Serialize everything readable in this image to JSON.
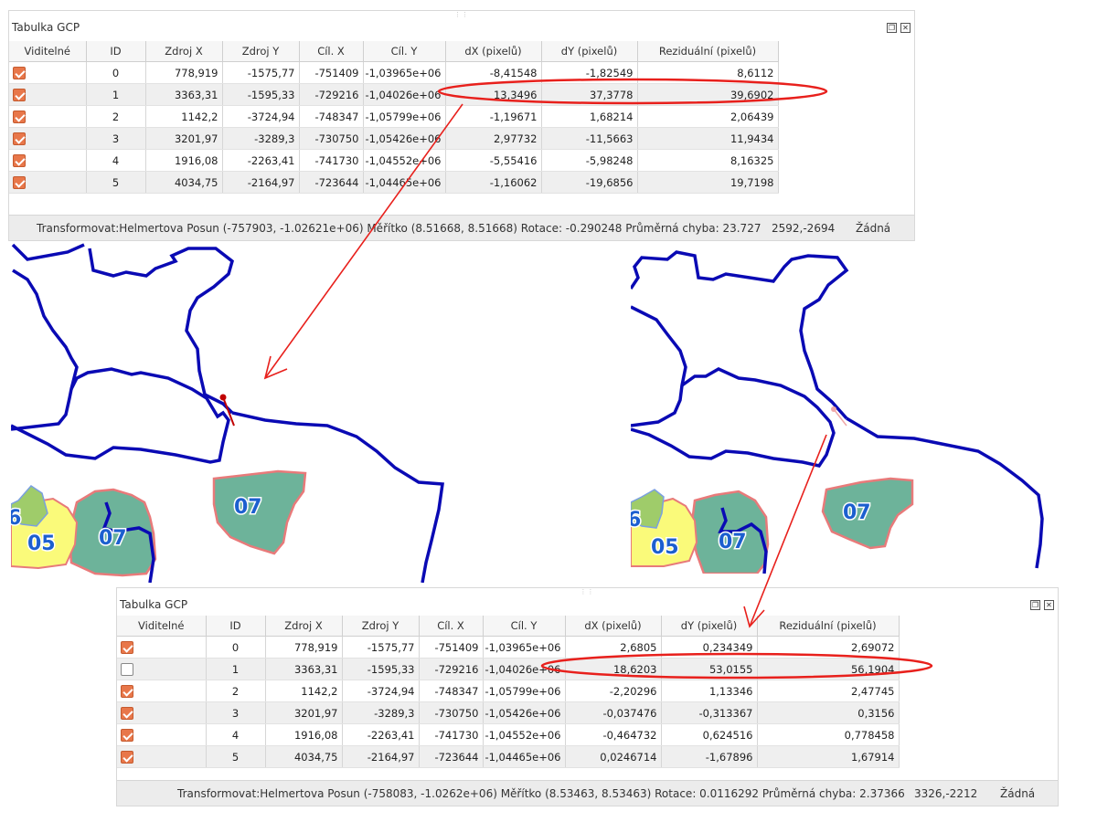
{
  "top_panel": {
    "title": "Tabulka GCP",
    "columns": [
      "Viditelné",
      "ID",
      "Zdroj X",
      "Zdroj Y",
      "Cíl. X",
      "Cíl. Y",
      "dX (pixelů)",
      "dY (pixelů)",
      "Reziduální (pixelů)"
    ],
    "rows": [
      {
        "visible": true,
        "id": "0",
        "src_x": "778,919",
        "src_y": "-1575,77",
        "dst_x": "-751409",
        "dst_y": "-1,03965e+06",
        "dx": "-8,41548",
        "dy": "-1,82549",
        "res": "8,6112"
      },
      {
        "visible": true,
        "id": "1",
        "src_x": "3363,31",
        "src_y": "-1595,33",
        "dst_x": "-729216",
        "dst_y": "-1,04026e+06",
        "dx": "13,3496",
        "dy": "37,3778",
        "res": "39,6902"
      },
      {
        "visible": true,
        "id": "2",
        "src_x": "1142,2",
        "src_y": "-3724,94",
        "dst_x": "-748347",
        "dst_y": "-1,05799e+06",
        "dx": "-1,19671",
        "dy": "1,68214",
        "res": "2,06439"
      },
      {
        "visible": true,
        "id": "3",
        "src_x": "3201,97",
        "src_y": "-3289,3",
        "dst_x": "-730750",
        "dst_y": "-1,05426e+06",
        "dx": "2,97732",
        "dy": "-11,5663",
        "res": "11,9434"
      },
      {
        "visible": true,
        "id": "4",
        "src_x": "1916,08",
        "src_y": "-2263,41",
        "dst_x": "-741730",
        "dst_y": "-1,04552e+06",
        "dx": "-5,55416",
        "dy": "-5,98248",
        "res": "8,16325"
      },
      {
        "visible": true,
        "id": "5",
        "src_x": "4034,75",
        "src_y": "-2164,97",
        "dst_x": "-723644",
        "dst_y": "-1,04465e+06",
        "dx": "-1,16062",
        "dy": "-19,6856",
        "res": "19,7198"
      }
    ],
    "status_text": "Transformovat:Helmertova Posun (-757903, -1.02621e+06) Měřítko (8.51668, 8.51668) Rotace: -0.290248 Průměrná chyba: 23.727",
    "coords": "2592,-2694",
    "crs": "Žádná"
  },
  "bottom_panel": {
    "title": "Tabulka GCP",
    "columns": [
      "Viditelné",
      "ID",
      "Zdroj X",
      "Zdroj Y",
      "Cíl. X",
      "Cíl. Y",
      "dX (pixelů)",
      "dY (pixelů)",
      "Reziduální (pixelů)"
    ],
    "rows": [
      {
        "visible": true,
        "id": "0",
        "src_x": "778,919",
        "src_y": "-1575,77",
        "dst_x": "-751409",
        "dst_y": "-1,03965e+06",
        "dx": "2,6805",
        "dy": "0,234349",
        "res": "2,69072"
      },
      {
        "visible": false,
        "id": "1",
        "src_x": "3363,31",
        "src_y": "-1595,33",
        "dst_x": "-729216",
        "dst_y": "-1,04026e+06",
        "dx": "18,6203",
        "dy": "53,0155",
        "res": "56,1904"
      },
      {
        "visible": true,
        "id": "2",
        "src_x": "1142,2",
        "src_y": "-3724,94",
        "dst_x": "-748347",
        "dst_y": "-1,05799e+06",
        "dx": "-2,20296",
        "dy": "1,13346",
        "res": "2,47745"
      },
      {
        "visible": true,
        "id": "3",
        "src_x": "3201,97",
        "src_y": "-3289,3",
        "dst_x": "-730750",
        "dst_y": "-1,05426e+06",
        "dx": "-0,037476",
        "dy": "-0,313367",
        "res": "0,3156"
      },
      {
        "visible": true,
        "id": "4",
        "src_x": "1916,08",
        "src_y": "-2263,41",
        "dst_x": "-741730",
        "dst_y": "-1,04552e+06",
        "dx": "-0,464732",
        "dy": "0,624516",
        "res": "0,778458"
      },
      {
        "visible": true,
        "id": "5",
        "src_x": "4034,75",
        "src_y": "-2164,97",
        "dst_x": "-723644",
        "dst_y": "-1,04465e+06",
        "dx": "0,0246714",
        "dy": "-1,67896",
        "res": "1,67914"
      }
    ],
    "status_text": "Transformovat:Helmertova Posun (-758083, -1.0262e+06) Měřítko (8.53463, 8.53463) Rotace: 0.0116292 Průměrná chyba: 2.37366",
    "coords": "3326,-2212",
    "crs": "Žádná"
  },
  "map_left": {
    "labels": [
      "07",
      "05",
      "07",
      "6"
    ]
  },
  "map_right": {
    "labels": [
      "07",
      "05",
      "07",
      "6"
    ]
  },
  "colors": {
    "boundary": "#0a0ab4",
    "area_teal": "#6db39a",
    "area_yellow": "#fafa7a",
    "area_green": "#9fcc6a",
    "area_outline": "#e87a7a",
    "annotation_red": "#e8201c",
    "checkbox": "#e8774a",
    "label_text": "#1c5fcf"
  }
}
